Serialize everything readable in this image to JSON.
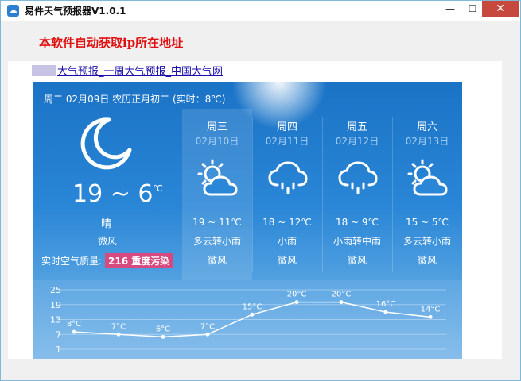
{
  "window": {
    "title": "易件天气预报器V1.0.1",
    "min": "—",
    "max": "☐",
    "close": "✕"
  },
  "notice": "本软件自动获取ip所在地址",
  "links": [
    "大气预报",
    "一周大气预报",
    "中国大气网"
  ],
  "link_sep": "_",
  "weather": {
    "date_line": "周二 02月09日 农历正月初二 (实时：8℃)",
    "today": {
      "temp": "19 ~ 6",
      "unit": "℃",
      "condition": "晴",
      "wind": "微风",
      "aq_label": "实时空气质量:",
      "aq_value": "216 重度污染"
    },
    "days": [
      {
        "week": "周三",
        "date": "02月10日",
        "temp": "19 ~ 11℃",
        "cond": "多云转小雨",
        "wind": "微风",
        "icon": "partly-cloudy-icon"
      },
      {
        "week": "周四",
        "date": "02月11日",
        "temp": "18 ~ 12℃",
        "cond": "小雨",
        "wind": "微风",
        "icon": "rain-icon"
      },
      {
        "week": "周五",
        "date": "02月12日",
        "temp": "18 ~ 9℃",
        "cond": "小雨转中雨",
        "wind": "微风",
        "icon": "rain-icon"
      },
      {
        "week": "周六",
        "date": "02月13日",
        "temp": "15 ~ 5℃",
        "cond": "多云转小雨",
        "wind": "微风",
        "icon": "partly-cloudy-icon"
      }
    ],
    "colors": {
      "aq_badge": "#d84a7f",
      "panel_top": "#1b73c6",
      "panel_bottom": "#7db8ea"
    }
  },
  "chart_data": {
    "type": "line",
    "y_ticks": [
      25,
      19,
      13,
      7,
      1
    ],
    "ylim": [
      1,
      25
    ],
    "values": [
      8,
      7,
      6,
      7,
      15,
      20,
      20,
      16,
      14
    ],
    "value_labels": [
      "8°C",
      "7°C",
      "6°C",
      "7°C",
      "15°C",
      "20°C",
      "20°C",
      "16°C",
      "14°C"
    ],
    "grid": true
  }
}
